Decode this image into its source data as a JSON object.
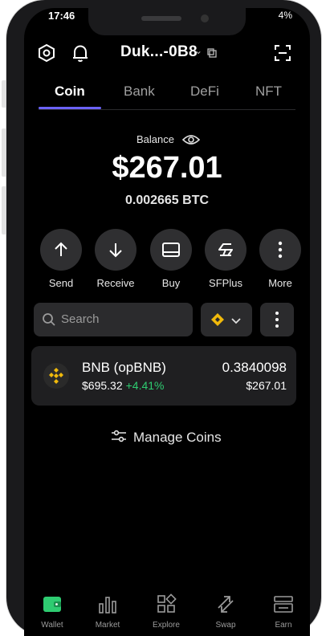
{
  "status": {
    "time": "17:46",
    "battery": "4%"
  },
  "header": {
    "wallet_name": "Duk...-0B8",
    "settings_icon": "settings-hexagon-icon",
    "notifications_icon": "bell-icon",
    "copy_icon": "copy-icon",
    "scan_icon": "scan-icon"
  },
  "tabs": [
    {
      "label": "Coin",
      "active": true
    },
    {
      "label": "Bank",
      "active": false
    },
    {
      "label": "DeFi",
      "active": false
    },
    {
      "label": "NFT",
      "active": false
    }
  ],
  "balance": {
    "label": "Balance",
    "fiat": "$267.01",
    "btc": "0.002665 BTC"
  },
  "actions": [
    {
      "label": "Send",
      "icon": "arrow-up-icon"
    },
    {
      "label": "Receive",
      "icon": "arrow-down-icon"
    },
    {
      "label": "Buy",
      "icon": "card-icon"
    },
    {
      "label": "SFPlus",
      "icon": "sfplus-icon"
    },
    {
      "label": "More",
      "icon": "more-vertical-icon"
    }
  ],
  "search": {
    "placeholder": "Search"
  },
  "coins": [
    {
      "name": "BNB (opBNB)",
      "price": "$695.32",
      "change": "+4.41%",
      "amount": "0.3840098",
      "value": "$267.01"
    }
  ],
  "manage": {
    "label": "Manage Coins"
  },
  "bottom_nav": [
    {
      "label": "Wallet",
      "icon": "wallet-icon",
      "active": true
    },
    {
      "label": "Market",
      "icon": "bar-chart-icon",
      "active": false
    },
    {
      "label": "Explore",
      "icon": "grid-icon",
      "active": false
    },
    {
      "label": "Swap",
      "icon": "swap-icon",
      "active": false
    },
    {
      "label": "Earn",
      "icon": "earn-icon",
      "active": false
    }
  ],
  "colors": {
    "accent": "#6c63ff",
    "positive": "#2ecc71",
    "bnb": "#f0b90b"
  }
}
